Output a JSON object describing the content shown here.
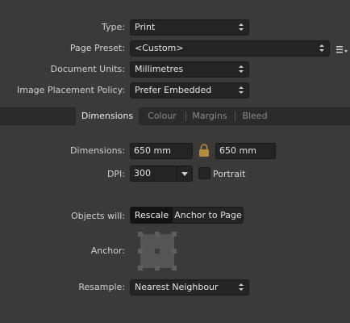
{
  "type": {
    "label": "Type:",
    "value": "Print"
  },
  "page_preset": {
    "label": "Page Preset:",
    "value": "<Custom>"
  },
  "document_units": {
    "label": "Document Units:",
    "value": "Millimetres"
  },
  "image_placement": {
    "label": "Image Placement Policy:",
    "value": "Prefer Embedded"
  },
  "tabs": [
    {
      "label": "Dimensions",
      "active": true
    },
    {
      "label": "Colour",
      "active": false
    },
    {
      "label": "Margins",
      "active": false
    },
    {
      "label": "Bleed",
      "active": false
    }
  ],
  "dimensions": {
    "label": "Dimensions:",
    "width": "650 mm",
    "height": "650 mm"
  },
  "dpi": {
    "label": "DPI:",
    "value": "300"
  },
  "portrait": {
    "label": "Portrait",
    "checked": false
  },
  "objects_will": {
    "label": "Objects will:",
    "options": [
      "Rescale",
      "Anchor to Page"
    ],
    "selected": "Rescale"
  },
  "anchor": {
    "label": "Anchor:"
  },
  "resample": {
    "label": "Resample:",
    "value": "Nearest Neighbour"
  },
  "colors": {
    "accent": "#b58a3c",
    "panel": "#3a3a3a",
    "field": "#242424",
    "tabbar": "#2b2b2b"
  }
}
